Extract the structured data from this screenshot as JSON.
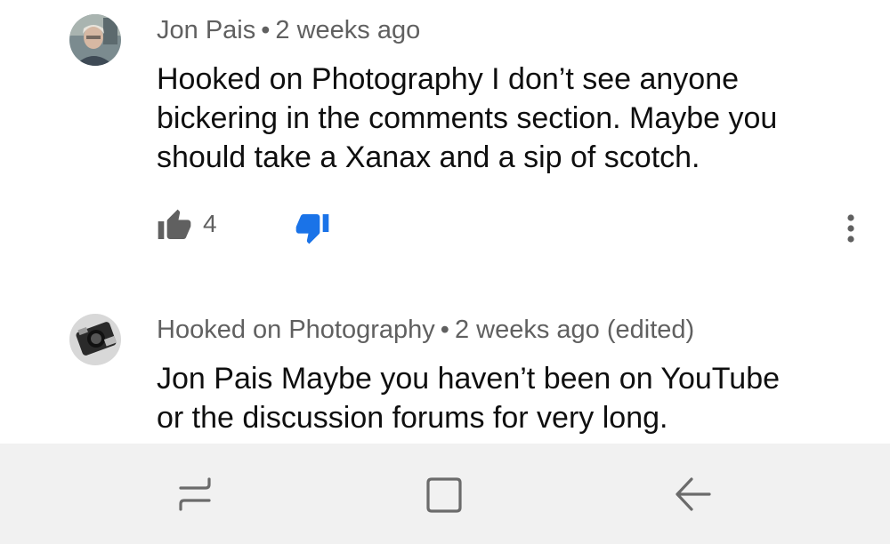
{
  "comments": [
    {
      "author": "Jon Pais",
      "time": "2 weeks ago",
      "text_lines": [
        "Hooked on Photography I don’t see anyone",
        "bickering in the comments section. Maybe you",
        "should take a Xanax and a sip of scotch."
      ],
      "likes": "4"
    },
    {
      "author": "Hooked on Photography",
      "time": "2 weeks ago (edited)",
      "text_lines": [
        "Jon Pais  Maybe you haven’t been on YouTube",
        "or the discussion forums for very long."
      ]
    }
  ],
  "icons": {
    "like": "thumbs-up-icon",
    "dislike": "thumbs-down-icon",
    "more": "more-vert-icon",
    "nav_recents": "recents-icon",
    "nav_home": "home-icon",
    "nav_back": "back-icon"
  },
  "colors": {
    "dislike_active": "#1a73e8",
    "meta_text": "#606060",
    "navbar_bg": "#f1f1f1"
  }
}
